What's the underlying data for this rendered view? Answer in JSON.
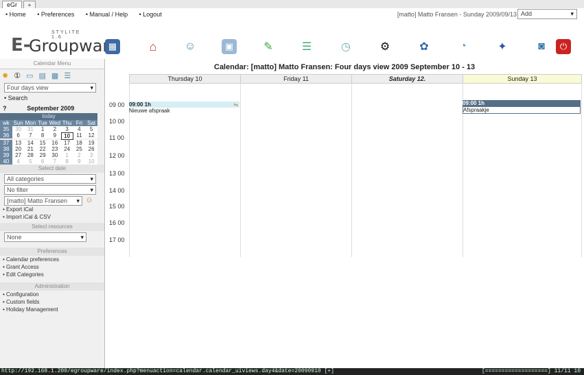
{
  "tab": {
    "label": "eGr",
    "new_tab": "+"
  },
  "nav": {
    "home": "Home",
    "preferences": "Preferences",
    "manual": "Manual / Help",
    "logout": "Logout"
  },
  "userinfo": "[matto] Matto Fransen - Sunday 2009/09/13",
  "add_select": {
    "label": "Add",
    "arrow": "▾"
  },
  "logo": {
    "subtitle": "STYLITE 1.6",
    "mark": "E-",
    "word": "Groupware"
  },
  "sidebar": {
    "title": "Calendar Menu",
    "view_select": "Four days view",
    "search": "Search",
    "mini_cal": {
      "month": "September 2009",
      "prev": "?",
      "nav_label": "today",
      "dow": [
        "wk",
        "Sun",
        "Mon",
        "Tue",
        "Wed",
        "Thu",
        "Fri",
        "Sat"
      ],
      "weeks": [
        [
          "35",
          "30",
          "31",
          "1",
          "2",
          "3",
          "4",
          "5"
        ],
        [
          "36",
          "6",
          "7",
          "8",
          "9",
          "10",
          "11",
          "12"
        ],
        [
          "37",
          "13",
          "14",
          "15",
          "16",
          "17",
          "18",
          "19"
        ],
        [
          "38",
          "20",
          "21",
          "22",
          "23",
          "24",
          "25",
          "26"
        ],
        [
          "39",
          "27",
          "28",
          "29",
          "30",
          "1",
          "2",
          "3"
        ],
        [
          "40",
          "4",
          "5",
          "6",
          "7",
          "8",
          "9",
          "10"
        ]
      ]
    },
    "select_date": "Select date",
    "category_select": "All categories",
    "filter_select": "No filter",
    "owner_select": "[matto] Matto Fransen",
    "export_ical": "Export iCal",
    "import_ical": "Import iCal & CSV",
    "resources_title": "Select resources",
    "resources_select": "None",
    "preferences_title": "Preferences",
    "pref_links": [
      "Calendar preferences",
      "Grant Access",
      "Edit Categories"
    ],
    "admin_title": "Administration",
    "admin_links": [
      "Configuration",
      "Custom fields",
      "Holiday Management"
    ]
  },
  "calendar": {
    "title": "Calendar: [matto] Matto Fransen: Four days view 2009 September 10 - 13",
    "days": [
      "Thursday 10",
      "Friday 11",
      "Saturday 12.",
      "Sunday 13"
    ],
    "times": [
      "09 00",
      "10 00",
      "11 00",
      "12 00",
      "13 00",
      "14 00",
      "15 00",
      "16 00",
      "17 00"
    ],
    "events": [
      {
        "day": "Thursday 10",
        "time": "09:00 1h",
        "title": "Nieuwe afspraak"
      },
      {
        "day": "Sunday 13",
        "time": "09:00 1h",
        "title": "Afspraakje"
      }
    ]
  },
  "statusbar": {
    "url": "http://192.168.1.200/egroupware/index.php?menuaction=calendar.calendar_uiviews.day4&date=20090910 [+]",
    "progress": "[===================] 11/11 10"
  },
  "colors": {
    "header_bar": "#556f86",
    "event_bg": "#d6eef5",
    "sunday_bg": "#fafad6"
  }
}
